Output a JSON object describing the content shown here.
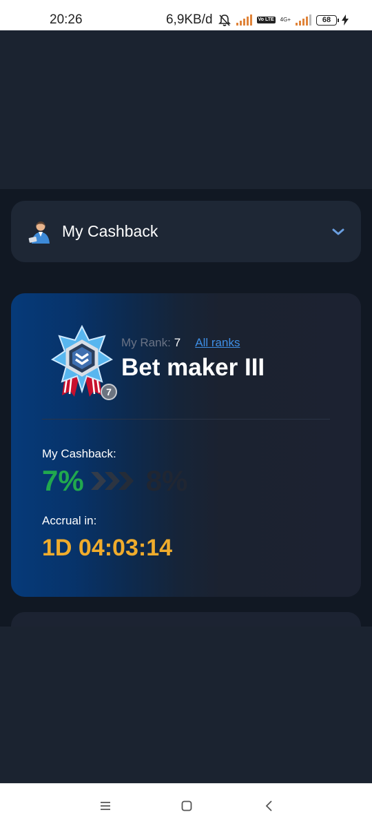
{
  "status_bar": {
    "time": "20:26",
    "network_speed": "6,9KB/d",
    "volte": "Vo LTE",
    "network_type": "4G+",
    "battery": "68"
  },
  "cashback_dropdown": {
    "label": "My Cashback",
    "icon": "user-avatar-icon",
    "expand_icon": "chevron-down-icon"
  },
  "rank_card": {
    "rank_label": "My Rank:",
    "rank_value": "7",
    "all_ranks_link": "All ranks",
    "rank_name": "Bet maker III",
    "rank_badge": "7",
    "cashback_label": "My Cashback:",
    "cashback_current": "7%",
    "cashback_next": "8%",
    "accrual_label": "Accrual in:",
    "accrual_timer": "1D 04:03:14"
  },
  "colors": {
    "cashback_current": "#21a84e",
    "timer": "#f0ac2c",
    "link": "#3e8fe6",
    "card_gradient_start": "#063a79"
  },
  "nav_bar": {
    "icons": [
      "menu-icon",
      "home-icon",
      "back-icon"
    ]
  }
}
